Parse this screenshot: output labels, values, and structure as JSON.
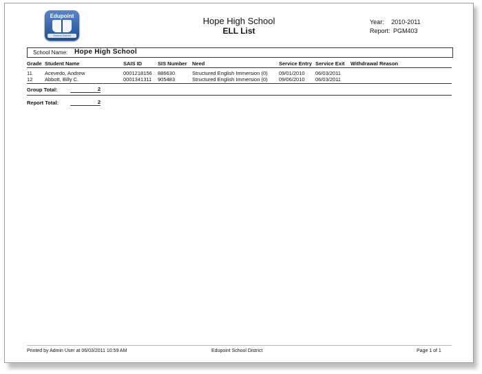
{
  "header": {
    "logo_text": "Edupoint",
    "logo_subtext": "School District",
    "school_title": "Hope High School",
    "report_title": "ELL List",
    "year_label": "Year:",
    "year_value": "2010-2011",
    "report_label": "Report:",
    "report_value": "PGM403"
  },
  "school_box": {
    "label": "School Name:",
    "value": "Hope High School"
  },
  "columns": [
    "Grade",
    "Student Name",
    "SAIS ID",
    "SIS Number",
    "Need",
    "Service Entry",
    "Service Exit",
    "Withdrawal Reason"
  ],
  "rows": [
    [
      "11",
      "Acevedo, Andrew",
      "0001218156",
      "886630",
      "Structured English Immersion (0)",
      "09/01/2010",
      "06/03/2011",
      ""
    ],
    [
      "12",
      "Abbott, Billy C.",
      "0001341311",
      "905483",
      "Structured English Immersion (0)",
      "09/06/2010",
      "06/03/2011",
      ""
    ]
  ],
  "group_total": {
    "label": "Group Total:",
    "value": "2"
  },
  "report_total": {
    "label": "Report Total:",
    "value": "2"
  },
  "footer": {
    "printed_by": "Printed by Admin User at 06/03/2011 10:59 AM",
    "district": "Edupoint School District",
    "page": "Page 1 of 1"
  }
}
